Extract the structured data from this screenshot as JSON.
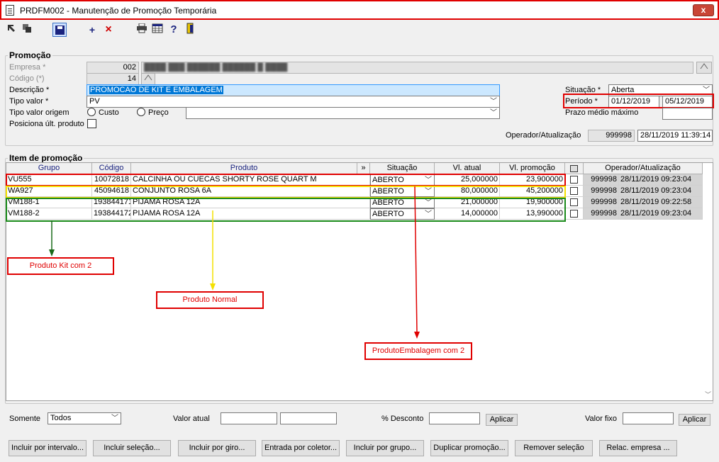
{
  "window": {
    "title": "PRDFM002 - Manutenção de Promoção Temporária",
    "close_label": "x"
  },
  "toolbar": {
    "icons": [
      "arrow-select-icon",
      "copy-icon",
      "save-icon",
      "add-icon",
      "delete-icon",
      "print-icon",
      "grid-icon",
      "help-icon",
      "exit-icon"
    ],
    "add_glyph": "+",
    "delete_glyph": "×",
    "help_glyph": "?"
  },
  "promocao": {
    "group_label": "Promoção",
    "empresa_label": "Empresa *",
    "empresa_code": "002",
    "empresa_name": "████ ███ ██████ ██████ █ ████",
    "codigo_label": "Código (*)",
    "codigo_value": "14",
    "descricao_label": "Descrição *",
    "descricao_value": "PROMOCAO DE KIT E EMBALAGEM",
    "tipo_valor_label": "Tipo valor *",
    "tipo_valor_value": "PV",
    "tipo_valor_origem_label": "Tipo valor origem",
    "radio_custo": "Custo",
    "radio_preco": "Preço",
    "posiciona_label": "Posiciona últ. produto",
    "situacao_label": "Situação *",
    "situacao_value": "Aberta",
    "periodo_label": "Período *",
    "periodo_inicio": "01/12/2019",
    "periodo_fim": "05/12/2019",
    "prazo_label": "Prazo médio máximo",
    "prazo_value": "",
    "operador_label": "Operador/Atualização",
    "operador_value": "999998",
    "atualizacao_value": "28/11/2019 11:39:14"
  },
  "itens": {
    "group_label": "Item de promoção",
    "columns": [
      "Grupo",
      "Código",
      "Produto",
      "»",
      "Situação",
      "Vl. atual",
      "Vl. promoção",
      "",
      "Operador/Atualização"
    ],
    "rows": [
      {
        "grupo": "VU555",
        "codigo": "10072818",
        "produto": "CALCINHA OU CUECAS SHORTY ROSE QUART M",
        "situacao": "ABERTO",
        "vl_atual": "25,000000",
        "vl_promocao": "23,900000",
        "operador": "999998",
        "atualizacao": "28/11/2019 09:23:04"
      },
      {
        "grupo": "WA927",
        "codigo": "45094618",
        "produto": "CONJUNTO ROSA 6A",
        "situacao": "ABERTO",
        "vl_atual": "80,000000",
        "vl_promocao": "45,200000",
        "operador": "999998",
        "atualizacao": "28/11/2019 09:23:04"
      },
      {
        "grupo": "VM188-1",
        "codigo": "193844171",
        "produto": "PIJAMA ROSA 12A",
        "situacao": "ABERTO",
        "vl_atual": "21,000000",
        "vl_promocao": "19,900000",
        "operador": "999998",
        "atualizacao": "28/11/2019 09:22:58"
      },
      {
        "grupo": "VM188-2",
        "codigo": "193844172",
        "produto": "PIJAMA ROSA 12A",
        "situacao": "ABERTO",
        "vl_atual": "14,000000",
        "vl_promocao": "13,990000",
        "operador": "999998",
        "atualizacao": "28/11/2019 09:23:04"
      }
    ]
  },
  "annotations": {
    "kit": "Produto Kit com 2",
    "normal": "Produto Normal",
    "embalagem": "ProdutoEmbalagem com 2"
  },
  "filters": {
    "somente_label": "Somente",
    "somente_value": "Todos",
    "valor_atual_label": "Valor atual",
    "desconto_label": "% Desconto",
    "aplicar_label": "Aplicar",
    "valor_fixo_label": "Valor fixo",
    "aplicar2_label": "Aplicar"
  },
  "buttons": [
    "Incluir por intervalo...",
    "Incluir seleção...",
    "Incluir por giro...",
    "Entrada por coletor...",
    "Incluir por grupo...",
    "Duplicar promoção...",
    "Remover seleção",
    "Relac. empresa ..."
  ],
  "colors": {
    "highlight_red": "#e00000",
    "highlight_yellow": "#f4e000",
    "highlight_green": "#1a8a1a",
    "selection_blue": "#0078d7",
    "header_text": "#1a237e"
  }
}
